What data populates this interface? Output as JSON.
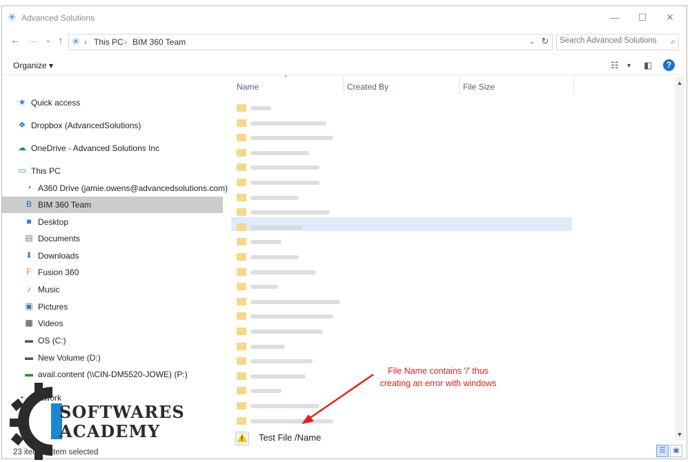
{
  "window": {
    "title": "Advanced Solutions",
    "buttons": {
      "minimize": "—",
      "maximize": "☐",
      "close": "✕"
    }
  },
  "address": {
    "crumbs": [
      "This PC",
      "BIM 360 Team"
    ],
    "separator": "›",
    "search_placeholder": "Search Advanced Solutions"
  },
  "toolbar": {
    "organize_label": "Organize ▾"
  },
  "sidebar": {
    "items": [
      {
        "label": "Quick access",
        "icon": "star-icon",
        "glyph": "★",
        "color": "#2f7fd6"
      },
      {
        "label": "Dropbox (AdvancedSolutions)",
        "icon": "dropbox-icon",
        "glyph": "❖",
        "color": "#1f7bd6"
      },
      {
        "label": "OneDrive - Advanced Solutions Inc",
        "icon": "onedrive-icon",
        "glyph": "☁",
        "color": "#2d8f4f"
      },
      {
        "label": "This PC",
        "icon": "computer-icon",
        "glyph": "▭",
        "color": "#2f7fd6"
      },
      {
        "label": "A360 Drive (jamie.owens@advancedsolutions.com)",
        "icon": "a360-drive-icon",
        "glyph": "◔",
        "color": "#666666"
      },
      {
        "label": "BIM 360 Team",
        "icon": "bim360-icon",
        "glyph": "B",
        "color": "#1f5fb0"
      },
      {
        "label": "Desktop",
        "icon": "desktop-icon",
        "glyph": "■",
        "color": "#2f7fd6"
      },
      {
        "label": "Documents",
        "icon": "documents-icon",
        "glyph": "▤",
        "color": "#7a7a7a"
      },
      {
        "label": "Downloads",
        "icon": "downloads-icon",
        "glyph": "⬇",
        "color": "#2f7fd6"
      },
      {
        "label": "Fusion 360",
        "icon": "fusion360-icon",
        "glyph": "F",
        "color": "#e87d1e"
      },
      {
        "label": "Music",
        "icon": "music-icon",
        "glyph": "♪",
        "color": "#2f7fd6"
      },
      {
        "label": "Pictures",
        "icon": "pictures-icon",
        "glyph": "▣",
        "color": "#4a6fa5"
      },
      {
        "label": "Videos",
        "icon": "videos-icon",
        "glyph": "▦",
        "color": "#333333"
      },
      {
        "label": "OS (C:)",
        "icon": "drive-c-icon",
        "glyph": "▬",
        "color": "#555555"
      },
      {
        "label": "New Volume (D:)",
        "icon": "drive-d-icon",
        "glyph": "▬",
        "color": "#555555"
      },
      {
        "label": "avail.content (\\\\CIN-DM5520-JOWE) (P:)",
        "icon": "network-drive-icon",
        "glyph": "▬",
        "color": "#3a8a3a"
      },
      {
        "label": "Network",
        "icon": "network-icon",
        "glyph": "▪",
        "color": "#2f7fd6"
      }
    ]
  },
  "columns": [
    "Name",
    "Created By",
    "File Size"
  ],
  "file": {
    "name": "Test File /Name",
    "icon": "warning-icon"
  },
  "annotation": {
    "line1": "File Name contains '/' thus",
    "line2": "creating an error with windows"
  },
  "status": {
    "items": "23 items",
    "selected": "1 item selected"
  },
  "logo": {
    "line1": "SOFTWARES",
    "line2": "ACADEMY"
  },
  "colors": {
    "annotation": "#e0201a",
    "selection": "#cccccc",
    "highlight": "#deecf9",
    "folder": "#f4d98a"
  }
}
